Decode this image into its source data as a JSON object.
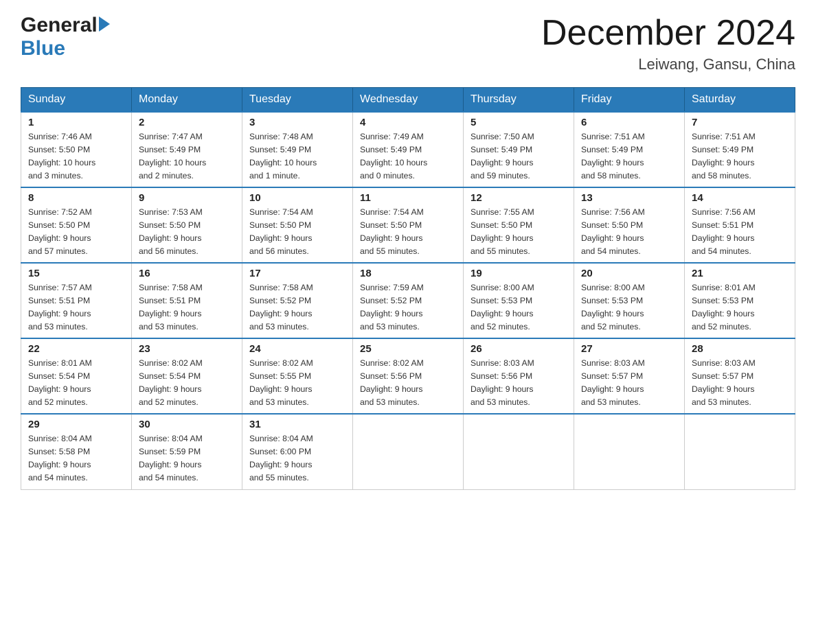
{
  "logo": {
    "general": "General",
    "blue": "Blue"
  },
  "title": {
    "month": "December 2024",
    "location": "Leiwang, Gansu, China"
  },
  "days_of_week": [
    "Sunday",
    "Monday",
    "Tuesday",
    "Wednesday",
    "Thursday",
    "Friday",
    "Saturday"
  ],
  "weeks": [
    [
      {
        "day": "1",
        "info": "Sunrise: 7:46 AM\nSunset: 5:50 PM\nDaylight: 10 hours\nand 3 minutes."
      },
      {
        "day": "2",
        "info": "Sunrise: 7:47 AM\nSunset: 5:49 PM\nDaylight: 10 hours\nand 2 minutes."
      },
      {
        "day": "3",
        "info": "Sunrise: 7:48 AM\nSunset: 5:49 PM\nDaylight: 10 hours\nand 1 minute."
      },
      {
        "day": "4",
        "info": "Sunrise: 7:49 AM\nSunset: 5:49 PM\nDaylight: 10 hours\nand 0 minutes."
      },
      {
        "day": "5",
        "info": "Sunrise: 7:50 AM\nSunset: 5:49 PM\nDaylight: 9 hours\nand 59 minutes."
      },
      {
        "day": "6",
        "info": "Sunrise: 7:51 AM\nSunset: 5:49 PM\nDaylight: 9 hours\nand 58 minutes."
      },
      {
        "day": "7",
        "info": "Sunrise: 7:51 AM\nSunset: 5:49 PM\nDaylight: 9 hours\nand 58 minutes."
      }
    ],
    [
      {
        "day": "8",
        "info": "Sunrise: 7:52 AM\nSunset: 5:50 PM\nDaylight: 9 hours\nand 57 minutes."
      },
      {
        "day": "9",
        "info": "Sunrise: 7:53 AM\nSunset: 5:50 PM\nDaylight: 9 hours\nand 56 minutes."
      },
      {
        "day": "10",
        "info": "Sunrise: 7:54 AM\nSunset: 5:50 PM\nDaylight: 9 hours\nand 56 minutes."
      },
      {
        "day": "11",
        "info": "Sunrise: 7:54 AM\nSunset: 5:50 PM\nDaylight: 9 hours\nand 55 minutes."
      },
      {
        "day": "12",
        "info": "Sunrise: 7:55 AM\nSunset: 5:50 PM\nDaylight: 9 hours\nand 55 minutes."
      },
      {
        "day": "13",
        "info": "Sunrise: 7:56 AM\nSunset: 5:50 PM\nDaylight: 9 hours\nand 54 minutes."
      },
      {
        "day": "14",
        "info": "Sunrise: 7:56 AM\nSunset: 5:51 PM\nDaylight: 9 hours\nand 54 minutes."
      }
    ],
    [
      {
        "day": "15",
        "info": "Sunrise: 7:57 AM\nSunset: 5:51 PM\nDaylight: 9 hours\nand 53 minutes."
      },
      {
        "day": "16",
        "info": "Sunrise: 7:58 AM\nSunset: 5:51 PM\nDaylight: 9 hours\nand 53 minutes."
      },
      {
        "day": "17",
        "info": "Sunrise: 7:58 AM\nSunset: 5:52 PM\nDaylight: 9 hours\nand 53 minutes."
      },
      {
        "day": "18",
        "info": "Sunrise: 7:59 AM\nSunset: 5:52 PM\nDaylight: 9 hours\nand 53 minutes."
      },
      {
        "day": "19",
        "info": "Sunrise: 8:00 AM\nSunset: 5:53 PM\nDaylight: 9 hours\nand 52 minutes."
      },
      {
        "day": "20",
        "info": "Sunrise: 8:00 AM\nSunset: 5:53 PM\nDaylight: 9 hours\nand 52 minutes."
      },
      {
        "day": "21",
        "info": "Sunrise: 8:01 AM\nSunset: 5:53 PM\nDaylight: 9 hours\nand 52 minutes."
      }
    ],
    [
      {
        "day": "22",
        "info": "Sunrise: 8:01 AM\nSunset: 5:54 PM\nDaylight: 9 hours\nand 52 minutes."
      },
      {
        "day": "23",
        "info": "Sunrise: 8:02 AM\nSunset: 5:54 PM\nDaylight: 9 hours\nand 52 minutes."
      },
      {
        "day": "24",
        "info": "Sunrise: 8:02 AM\nSunset: 5:55 PM\nDaylight: 9 hours\nand 53 minutes."
      },
      {
        "day": "25",
        "info": "Sunrise: 8:02 AM\nSunset: 5:56 PM\nDaylight: 9 hours\nand 53 minutes."
      },
      {
        "day": "26",
        "info": "Sunrise: 8:03 AM\nSunset: 5:56 PM\nDaylight: 9 hours\nand 53 minutes."
      },
      {
        "day": "27",
        "info": "Sunrise: 8:03 AM\nSunset: 5:57 PM\nDaylight: 9 hours\nand 53 minutes."
      },
      {
        "day": "28",
        "info": "Sunrise: 8:03 AM\nSunset: 5:57 PM\nDaylight: 9 hours\nand 53 minutes."
      }
    ],
    [
      {
        "day": "29",
        "info": "Sunrise: 8:04 AM\nSunset: 5:58 PM\nDaylight: 9 hours\nand 54 minutes."
      },
      {
        "day": "30",
        "info": "Sunrise: 8:04 AM\nSunset: 5:59 PM\nDaylight: 9 hours\nand 54 minutes."
      },
      {
        "day": "31",
        "info": "Sunrise: 8:04 AM\nSunset: 6:00 PM\nDaylight: 9 hours\nand 55 minutes."
      },
      {
        "day": "",
        "info": ""
      },
      {
        "day": "",
        "info": ""
      },
      {
        "day": "",
        "info": ""
      },
      {
        "day": "",
        "info": ""
      }
    ]
  ]
}
